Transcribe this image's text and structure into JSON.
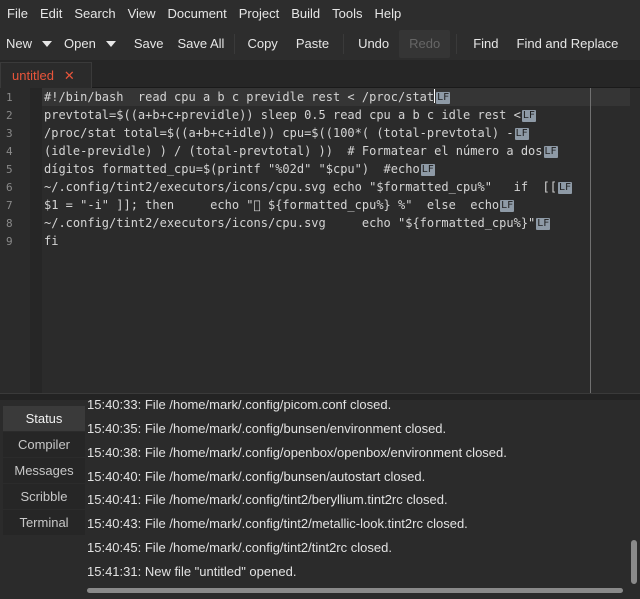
{
  "menubar": {
    "items": [
      "File",
      "Edit",
      "Search",
      "View",
      "Document",
      "Project",
      "Build",
      "Tools",
      "Help"
    ]
  },
  "toolbar": {
    "new_label": "New",
    "open_label": "Open",
    "save_label": "Save",
    "save_all_label": "Save All",
    "copy_label": "Copy",
    "paste_label": "Paste",
    "undo_label": "Undo",
    "redo_label": "Redo",
    "find_label": "Find",
    "find_replace_label": "Find and Replace"
  },
  "tabs": [
    {
      "label": "untitled",
      "close_glyph": "✕"
    }
  ],
  "editor": {
    "eol_marker": "LF",
    "line_numbers": [
      "1",
      "2",
      "3",
      "4",
      "5",
      "6",
      "7",
      "8",
      "9"
    ],
    "lines": [
      "#!/bin/bash  read cpu a b c previdle rest < /proc/stat",
      "prevtotal=$((a+b+c+previdle)) sleep 0.5 read cpu a b c idle rest <",
      "/proc/stat total=$((a+b+c+idle)) cpu=$((100*( (total-prevtotal) -",
      "(idle-previdle) ) / (total-prevtotal) ))  # Formatear el número a dos",
      "dígitos formatted_cpu=$(printf \"%02d\" \"$cpu\")  #echo",
      "~/.config/tint2/executors/icons/cpu.svg echo \"$formatted_cpu%\"   if  [[",
      "$1 = \"-i\" ]]; then     echo \" ${formatted_cpu%} %\"  else  echo",
      "~/.config/tint2/executors/icons/cpu.svg     echo \"${formatted_cpu%}\"",
      "fi"
    ],
    "line_endings": [
      true,
      true,
      true,
      true,
      true,
      true,
      true,
      true,
      false
    ]
  },
  "sidebar": {
    "tabs": [
      "Status",
      "Compiler",
      "Messages",
      "Scribble",
      "Terminal"
    ],
    "active": "Status"
  },
  "status_log": [
    "15:40:33: File /home/mark/.config/picom.conf closed.",
    "15:40:35: File /home/mark/.config/bunsen/environment closed.",
    "15:40:38: File /home/mark/.config/openbox/openbox/environment closed.",
    "15:40:40: File /home/mark/.config/bunsen/autostart closed.",
    "15:40:41: File /home/mark/.config/tint2/beryllium.tint2rc closed.",
    "15:40:43: File /home/mark/.config/tint2/metallic-look.tint2rc closed.",
    "15:40:45: File /home/mark/.config/tint2/tint2rc closed.",
    "15:41:31: New file \"untitled\" opened."
  ],
  "colors": {
    "tab_accent": "#e8553b",
    "background": "#2b2b2b",
    "eol_marker_bg": "#8e9aa6"
  }
}
